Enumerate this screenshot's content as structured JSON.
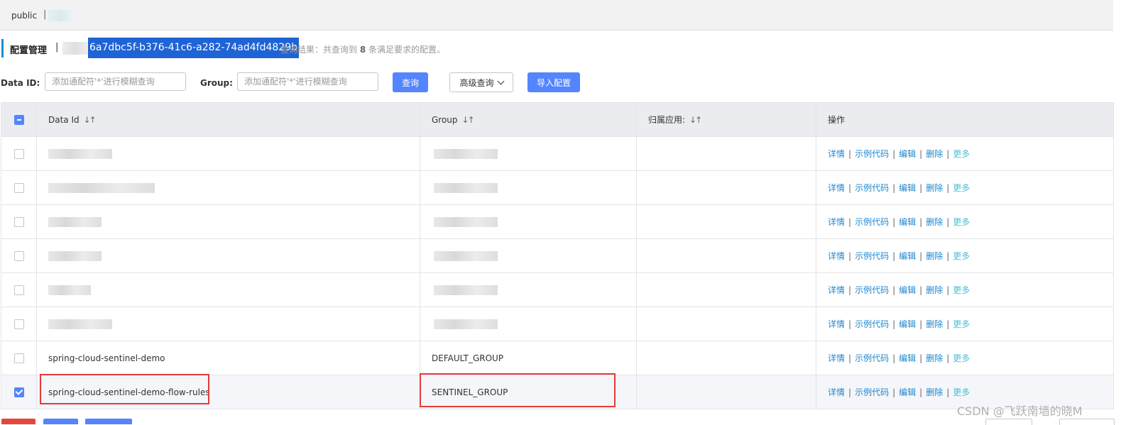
{
  "namespace_bar": {
    "public_label": "public",
    "separator": "|"
  },
  "header": {
    "title": "配置管理",
    "separator": "|",
    "namespace_id": "6a7dbc5f-b376-41c6-a282-74ad4fd4829b",
    "result_prefix": "查询结果：共查询到",
    "result_count": "8",
    "result_suffix": "条满足要求的配置。"
  },
  "filters": {
    "data_id_label": "Data ID:",
    "data_id_placeholder": "添加通配符'*'进行模糊查询",
    "group_label": "Group:",
    "group_placeholder": "添加通配符'*'进行模糊查询",
    "query_button": "查询",
    "advanced_button": "高级查询",
    "import_button": "导入配置"
  },
  "table": {
    "columns": [
      "Data Id",
      "Group",
      "归属应用:",
      "操作"
    ],
    "sort_glyph": "↓↑",
    "operations": [
      "详情",
      "示例代码",
      "编辑",
      "删除",
      "更多"
    ],
    "rows": [
      {
        "data_id": "",
        "group": "",
        "app": "",
        "checked": false,
        "blurred": true
      },
      {
        "data_id": "",
        "group": "",
        "app": "",
        "checked": false,
        "blurred": true
      },
      {
        "data_id": "",
        "group": "",
        "app": "",
        "checked": false,
        "blurred": true
      },
      {
        "data_id": "",
        "group": "",
        "app": "",
        "checked": false,
        "blurred": true
      },
      {
        "data_id": "",
        "group": "",
        "app": "",
        "checked": false,
        "blurred": true
      },
      {
        "data_id": "",
        "group": "",
        "app": "",
        "checked": false,
        "blurred": true
      },
      {
        "data_id": "spring-cloud-sentinel-demo",
        "group": "DEFAULT_GROUP",
        "app": "",
        "checked": false,
        "blurred": false
      },
      {
        "data_id": "spring-cloud-sentinel-demo-flow-rules",
        "group": "SENTINEL_GROUP",
        "app": "",
        "checked": true,
        "blurred": false
      }
    ]
  },
  "watermark": "CSDN @飞跃南墙的晓M",
  "colors": {
    "primary": "#5584ff",
    "link": "#1d87d0",
    "more_link": "#4ac0d6",
    "highlight_border": "#e53a3a",
    "selection_bg": "#1e64d6"
  }
}
